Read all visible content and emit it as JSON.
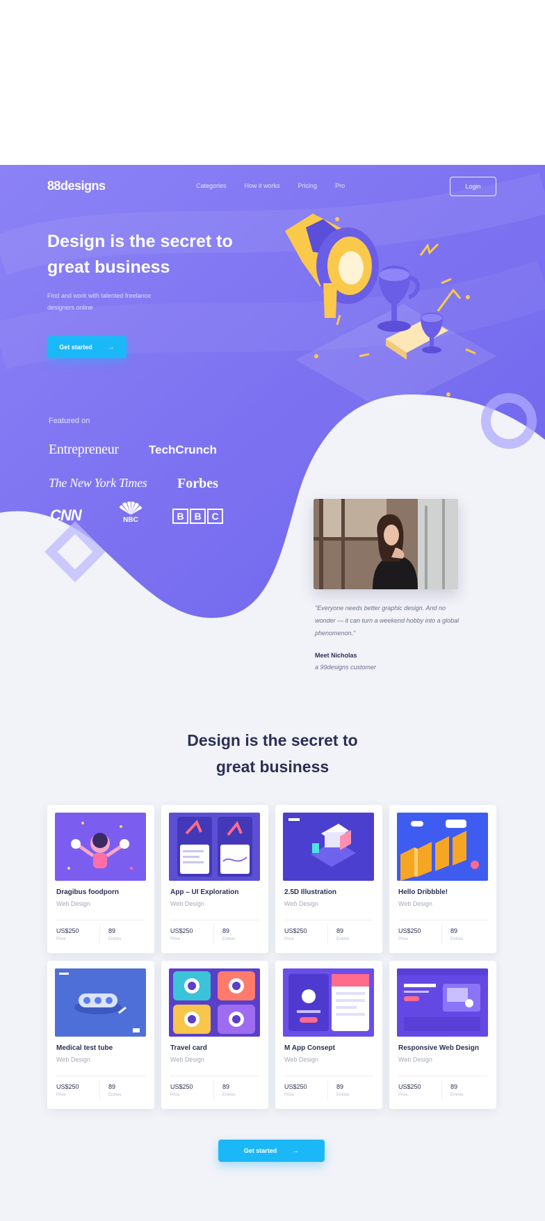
{
  "colors": {
    "accent": "#1bb8f8",
    "hero": "#7c72f2",
    "background": "#f1f3f8",
    "heading": "#2c2f55"
  },
  "nav": {
    "logo": "88designs",
    "links": [
      "Categories",
      "How it works",
      "Pricing",
      "Pro"
    ],
    "login": "Login"
  },
  "hero": {
    "title": "Design is the secret to great business",
    "subtitle": "Find and work with talented freelance designers online",
    "cta": "Get started",
    "featured_label": "Featured on",
    "press": [
      "Entrepreneur",
      "TechCrunch",
      "The New York Times",
      "Forbes",
      "CNN",
      "NBC",
      "BBC"
    ]
  },
  "testimonial": {
    "quote": "\"Everyone needs better graphic design. And no wonder — it can turn a weekend hobby into a global phenomenon.\"",
    "author": "Meet Nicholas",
    "role": "a 99designs customer"
  },
  "section": {
    "title": "Design is the secret to great business",
    "cta": "Get started"
  },
  "card_labels": {
    "price": "Price",
    "entries": "Entries"
  },
  "cards": [
    {
      "title": "Dragibus foodporn",
      "category": "Web Design",
      "price": "US$250",
      "entries": "89",
      "thumb": "character-illustration"
    },
    {
      "title": "App – UI Exploration",
      "category": "Web Design",
      "price": "US$250",
      "entries": "89",
      "thumb": "app-screens"
    },
    {
      "title": "2.5D Illustration",
      "category": "Web Design",
      "price": "US$250",
      "entries": "89",
      "thumb": "isometric-device"
    },
    {
      "title": "Hello Dribbble!",
      "category": "Web Design",
      "price": "US$250",
      "entries": "89",
      "thumb": "hello-letters"
    },
    {
      "title": "Medical test tube",
      "category": "Web Design",
      "price": "US$250",
      "entries": "89",
      "thumb": "test-tube"
    },
    {
      "title": "Travel card",
      "category": "Web Design",
      "price": "US$250",
      "entries": "89",
      "thumb": "travel-tiles"
    },
    {
      "title": "M App Consept",
      "category": "Web Design",
      "price": "US$250",
      "entries": "89",
      "thumb": "app-consept"
    },
    {
      "title": "Responsive Web Design",
      "category": "Web Design",
      "price": "US$250",
      "entries": "89",
      "thumb": "web-layout"
    }
  ]
}
